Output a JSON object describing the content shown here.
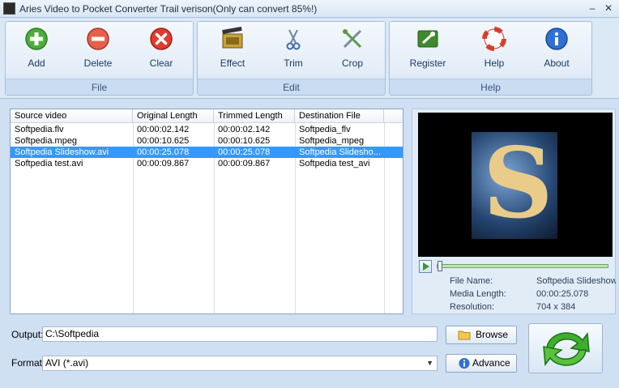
{
  "window": {
    "title": "Aries Video to Pocket Converter Trail verison(Only can convert 85%!)",
    "minimize": "–",
    "close": "✕"
  },
  "ribbon": {
    "file": {
      "label": "File",
      "buttons": [
        {
          "label": "Add",
          "icon": "add-icon"
        },
        {
          "label": "Delete",
          "icon": "delete-icon"
        },
        {
          "label": "Clear",
          "icon": "clear-icon"
        }
      ]
    },
    "edit": {
      "label": "Edit",
      "buttons": [
        {
          "label": "Effect",
          "icon": "film-effect-icon"
        },
        {
          "label": "Trim",
          "icon": "scissors-icon"
        },
        {
          "label": "Crop",
          "icon": "crop-tools-icon"
        }
      ]
    },
    "help": {
      "label": "Help",
      "buttons": [
        {
          "label": "Register",
          "icon": "register-icon"
        },
        {
          "label": "Help",
          "icon": "lifebuoy-icon"
        },
        {
          "label": "About",
          "icon": "info-icon"
        }
      ]
    }
  },
  "list": {
    "columns": [
      "Source video",
      "Original Length",
      "Trimmed Length",
      "Destination File"
    ],
    "rows": [
      [
        "Softpedia.flv",
        "00:00:02.142",
        "00:00:02.142",
        "Softpedia_flv"
      ],
      [
        "Softpedia.mpeg",
        "00:00:10.625",
        "00:00:10.625",
        "Softpedia_mpeg"
      ],
      [
        "Softpedia Slideshow.avi",
        "00:00:25.078",
        "00:00:25.078",
        "Softpedia Slidesho..."
      ],
      [
        "Softpedia test.avi",
        "00:00:09.867",
        "00:00:09.867",
        "Softpedia test_avi"
      ]
    ],
    "selected_row": 2
  },
  "preview": {
    "poster_letter": "S",
    "seek_progress": 0.01,
    "info": [
      {
        "key": "File Name:",
        "value": "Softpedia Slideshow."
      },
      {
        "key": "Media Length:",
        "value": "00:00:25.078"
      },
      {
        "key": "Resolution:",
        "value": "704 x 384"
      }
    ]
  },
  "output": {
    "label": "Output:",
    "value": "C:\\Softpedia",
    "browse_label": "Browse"
  },
  "format": {
    "label": "Format:",
    "value": "AVI (*.avi)",
    "advance_label": "Advance"
  },
  "colors": {
    "accent": "#3399ff",
    "ribbon_text": "#1c3a68",
    "background": "#cfe0f3"
  }
}
